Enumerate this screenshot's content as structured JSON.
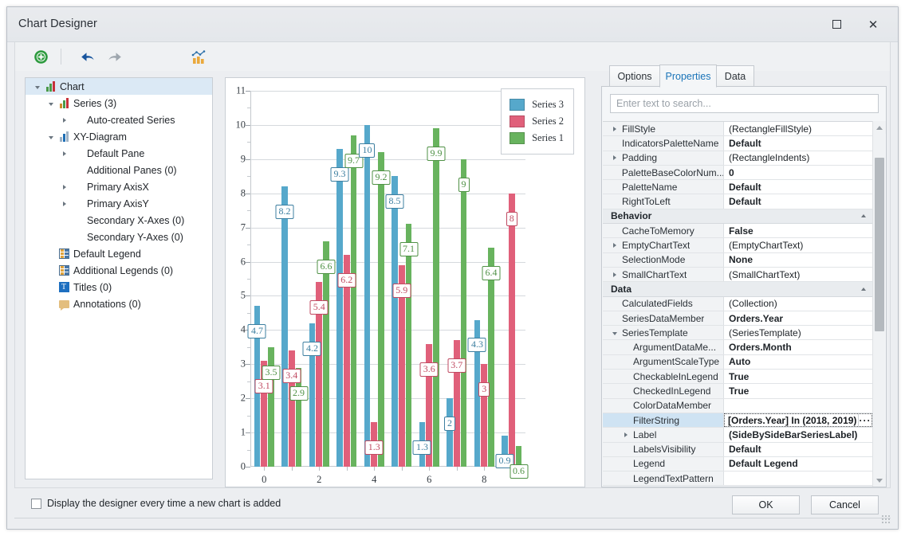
{
  "window": {
    "title": "Chart Designer",
    "maximize_icon": "maximize-icon",
    "close_icon": "close-icon",
    "close_glyph": "✕"
  },
  "toolbar": {
    "items": [
      {
        "name": "add-icon",
        "label": "Add"
      },
      {
        "name": "undo-icon",
        "label": "Undo"
      },
      {
        "name": "redo-icon",
        "label": "Redo"
      },
      {
        "name": "chart-wizard-icon",
        "label": "Chart Wizard"
      }
    ]
  },
  "tree": {
    "items": [
      {
        "label": "Chart",
        "level": 0,
        "expander": "expanded",
        "icon": "chart-bars-icon",
        "selected": true
      },
      {
        "label": "Series (3)",
        "level": 1,
        "expander": "expanded",
        "icon": "series-bars-icon",
        "selected": false
      },
      {
        "label": "Auto-created Series",
        "level": 2,
        "expander": "collapsed",
        "icon": "none",
        "selected": false
      },
      {
        "label": "XY-Diagram",
        "level": 1,
        "expander": "expanded",
        "icon": "diagram-bars-icon",
        "selected": false
      },
      {
        "label": "Default Pane",
        "level": 2,
        "expander": "collapsed",
        "icon": "none",
        "selected": false
      },
      {
        "label": "Additional Panes (0)",
        "level": 2,
        "expander": "none",
        "icon": "none",
        "selected": false
      },
      {
        "label": "Primary AxisX",
        "level": 2,
        "expander": "collapsed",
        "icon": "none",
        "selected": false
      },
      {
        "label": "Primary AxisY",
        "level": 2,
        "expander": "collapsed",
        "icon": "none",
        "selected": false
      },
      {
        "label": "Secondary X-Axes (0)",
        "level": 2,
        "expander": "none",
        "icon": "none",
        "selected": false
      },
      {
        "label": "Secondary Y-Axes (0)",
        "level": 2,
        "expander": "none",
        "icon": "none",
        "selected": false
      },
      {
        "label": "Default Legend",
        "level": 1,
        "expander": "none",
        "icon": "legend-icon",
        "selected": false
      },
      {
        "label": "Additional Legends (0)",
        "level": 1,
        "expander": "none",
        "icon": "legend-icon",
        "selected": false
      },
      {
        "label": "Titles (0)",
        "level": 1,
        "expander": "none",
        "icon": "title-text-icon",
        "selected": false
      },
      {
        "label": "Annotations (0)",
        "level": 1,
        "expander": "none",
        "icon": "annotation-icon",
        "selected": false
      }
    ]
  },
  "chart_data": {
    "type": "bar",
    "title": "",
    "xlabel": "",
    "ylabel": "",
    "ylim": [
      0,
      11
    ],
    "ytick_labels": [
      "0",
      "1",
      "2",
      "3",
      "4",
      "5",
      "6",
      "7",
      "8",
      "9",
      "10",
      "11"
    ],
    "yticks": [
      0,
      1,
      2,
      3,
      4,
      5,
      6,
      7,
      8,
      9,
      10,
      11
    ],
    "grid": true,
    "categories": [
      "0",
      "1",
      "2",
      "3",
      "4",
      "5",
      "6",
      "7",
      "8",
      "9"
    ],
    "xtick_labels": [
      "0",
      "2",
      "4",
      "6",
      "8"
    ],
    "legend_position": "top-right",
    "series": [
      {
        "name": "Series 3",
        "color": "#56a8cb",
        "label_color": "#3d7fa0",
        "values": [
          4.7,
          8.2,
          4.2,
          9.3,
          10,
          8.5,
          1.3,
          2,
          4.3,
          0.9
        ]
      },
      {
        "name": "Series 2",
        "color": "#e0607a",
        "label_color": "#c04a62",
        "values": [
          3.1,
          3.4,
          5.4,
          6.2,
          1.3,
          5.9,
          3.6,
          3.7,
          3,
          8
        ]
      },
      {
        "name": "Series 1",
        "color": "#68b35e",
        "label_color": "#4f9145",
        "values": [
          3.5,
          2.9,
          6.6,
          9.7,
          9.2,
          7.1,
          9.9,
          9,
          6.4,
          0.6
        ]
      }
    ]
  },
  "properties": {
    "tabs": [
      {
        "label": "Options",
        "active": false
      },
      {
        "label": "Properties",
        "active": true
      },
      {
        "label": "Data",
        "active": false
      }
    ],
    "search_placeholder": "Enter text to search...",
    "search_value": "",
    "rows": [
      {
        "kind": "prop",
        "indent": 1,
        "expander": "collapsed",
        "name": "FillStyle",
        "value": "(RectangleFillStyle)",
        "bold": false,
        "selected": false
      },
      {
        "kind": "prop",
        "indent": 1,
        "expander": "none",
        "name": "IndicatorsPaletteName",
        "value": "Default",
        "bold": true,
        "selected": false
      },
      {
        "kind": "prop",
        "indent": 1,
        "expander": "collapsed",
        "name": "Padding",
        "value": "(RectangleIndents)",
        "bold": false,
        "selected": false
      },
      {
        "kind": "prop",
        "indent": 1,
        "expander": "none",
        "name": "PaletteBaseColorNum...",
        "value": "0",
        "bold": true,
        "selected": false
      },
      {
        "kind": "prop",
        "indent": 1,
        "expander": "none",
        "name": "PaletteName",
        "value": "Default",
        "bold": true,
        "selected": false
      },
      {
        "kind": "prop",
        "indent": 1,
        "expander": "none",
        "name": "RightToLeft",
        "value": "Default",
        "bold": true,
        "selected": false
      },
      {
        "kind": "category",
        "name": "Behavior"
      },
      {
        "kind": "prop",
        "indent": 1,
        "expander": "none",
        "name": "CacheToMemory",
        "value": "False",
        "bold": true,
        "selected": false
      },
      {
        "kind": "prop",
        "indent": 1,
        "expander": "collapsed",
        "name": "EmptyChartText",
        "value": "(EmptyChartText)",
        "bold": false,
        "selected": false
      },
      {
        "kind": "prop",
        "indent": 1,
        "expander": "none",
        "name": "SelectionMode",
        "value": "None",
        "bold": true,
        "selected": false
      },
      {
        "kind": "prop",
        "indent": 1,
        "expander": "collapsed",
        "name": "SmallChartText",
        "value": "(SmallChartText)",
        "bold": false,
        "selected": false
      },
      {
        "kind": "category",
        "name": "Data"
      },
      {
        "kind": "prop",
        "indent": 1,
        "expander": "none",
        "name": "CalculatedFields",
        "value": "(Collection)",
        "bold": false,
        "selected": false
      },
      {
        "kind": "prop",
        "indent": 1,
        "expander": "none",
        "name": "SeriesDataMember",
        "value": "Orders.Year",
        "bold": true,
        "selected": false
      },
      {
        "kind": "prop",
        "indent": 1,
        "expander": "expanded",
        "name": "SeriesTemplate",
        "value": "(SeriesTemplate)",
        "bold": false,
        "selected": false
      },
      {
        "kind": "prop",
        "indent": 2,
        "expander": "none",
        "name": "ArgumentDataMe...",
        "value": "Orders.Month",
        "bold": true,
        "selected": false
      },
      {
        "kind": "prop",
        "indent": 2,
        "expander": "none",
        "name": "ArgumentScaleType",
        "value": "Auto",
        "bold": true,
        "selected": false
      },
      {
        "kind": "prop",
        "indent": 2,
        "expander": "none",
        "name": "CheckableInLegend",
        "value": "True",
        "bold": true,
        "selected": false
      },
      {
        "kind": "prop",
        "indent": 2,
        "expander": "none",
        "name": "CheckedInLegend",
        "value": "True",
        "bold": true,
        "selected": false
      },
      {
        "kind": "prop",
        "indent": 2,
        "expander": "none",
        "name": "ColorDataMember",
        "value": "",
        "bold": true,
        "selected": false
      },
      {
        "kind": "editing",
        "indent": 2,
        "expander": "none",
        "name": "FilterString",
        "value": "[Orders.Year] In (2018, 2019)",
        "ellipsis": "···",
        "selected": true
      },
      {
        "kind": "prop",
        "indent": 2,
        "expander": "collapsed",
        "name": "Label",
        "value": "(SideBySideBarSeriesLabel)",
        "bold": true,
        "selected": false
      },
      {
        "kind": "prop",
        "indent": 2,
        "expander": "none",
        "name": "LabelsVisibility",
        "value": "Default",
        "bold": true,
        "selected": false
      },
      {
        "kind": "prop",
        "indent": 2,
        "expander": "none",
        "name": "Legend",
        "value": "Default Legend",
        "bold": true,
        "selected": false
      },
      {
        "kind": "prop",
        "indent": 2,
        "expander": "none",
        "name": "LegendTextPattern",
        "value": "",
        "bold": true,
        "selected": false
      }
    ]
  },
  "footer": {
    "checkbox_label": "Display the designer every time a new chart is added",
    "checkbox_checked": false,
    "ok_label": "OK",
    "cancel_label": "Cancel"
  }
}
